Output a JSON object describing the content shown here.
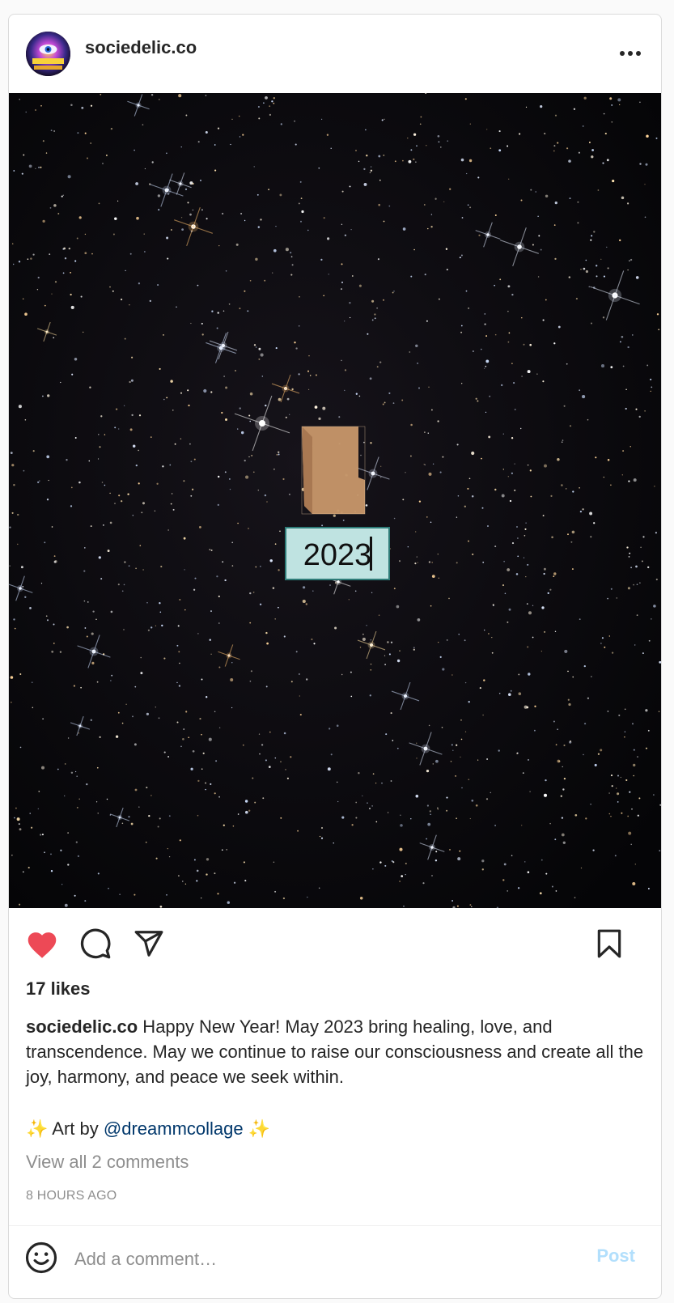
{
  "post": {
    "username": "sociedelic.co",
    "image_text": "2023",
    "likes_text": "17 likes",
    "caption_user": "sociedelic.co",
    "caption_text": " Happy New Year! May 2023 bring healing, love, and transcendence. May we continue to raise our consciousness and create all the joy, harmony, and peace we seek within.",
    "credit_prefix": "✨ Art by ",
    "credit_mention": "@dreammcollage",
    "credit_suffix": " ✨",
    "view_comments": "View all 2 comments",
    "timestamp": "8 HOURS AGO"
  },
  "icons": {
    "more": "more-options-icon",
    "like": "heart-icon",
    "comment": "comment-icon",
    "share": "share-icon",
    "save": "bookmark-icon",
    "emoji": "emoji-icon"
  },
  "comment_box": {
    "placeholder": "Add a comment…",
    "post_label": "Post"
  },
  "colors": {
    "heart": "#ed4956",
    "link": "#00376b",
    "post_disabled": "#b2dffc",
    "muted": "#8e8e8e"
  }
}
